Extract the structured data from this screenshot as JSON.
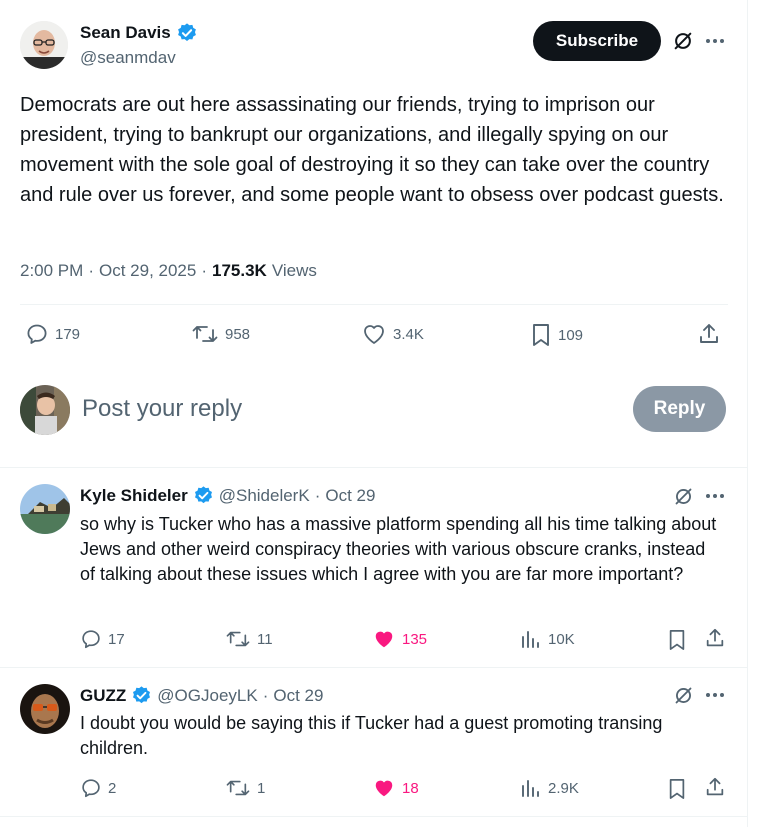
{
  "main_tweet": {
    "author_name": "Sean Davis",
    "author_handle": "@seanmdav",
    "subscribe_label": "Subscribe",
    "text": "Democrats are out here assassinating our friends, trying to imprison our president, trying to bankrupt our organizations, and illegally spying on our movement with the sole goal of destroying it so they can take over the country and rule over us forever, and some people want to obsess over podcast guests.",
    "time": "2:00 PM",
    "date": "Oct 29, 2025",
    "views_count": "175.3K",
    "views_label": "Views",
    "replies": "179",
    "reposts": "958",
    "likes": "3.4K",
    "bookmarks": "109"
  },
  "reply_box": {
    "placeholder": "Post your reply",
    "reply_label": "Reply"
  },
  "replies": [
    {
      "author_name": "Kyle Shideler",
      "author_handle": "@ShidelerK",
      "date": "Oct 29",
      "text": "so why is Tucker who has a massive platform spending all his time talking about Jews and other weird conspiracy theories with various obscure cranks, instead of talking about these issues which I agree with you are far more important?",
      "replies": "17",
      "reposts": "11",
      "likes": "135",
      "views": "10K"
    },
    {
      "author_name": "GUZZ",
      "author_handle": "@OGJoeyLK",
      "date": "Oct 29",
      "text": "I doubt you would be saying this if Tucker had a guest promoting transing children.",
      "replies": "2",
      "reposts": "1",
      "likes": "18",
      "views": "2.9K"
    }
  ],
  "colors": {
    "verified_blue": "#1d9bf0",
    "like_pink": "#f91880",
    "muted_gray": "#536471",
    "text_dark": "#0f1419"
  }
}
